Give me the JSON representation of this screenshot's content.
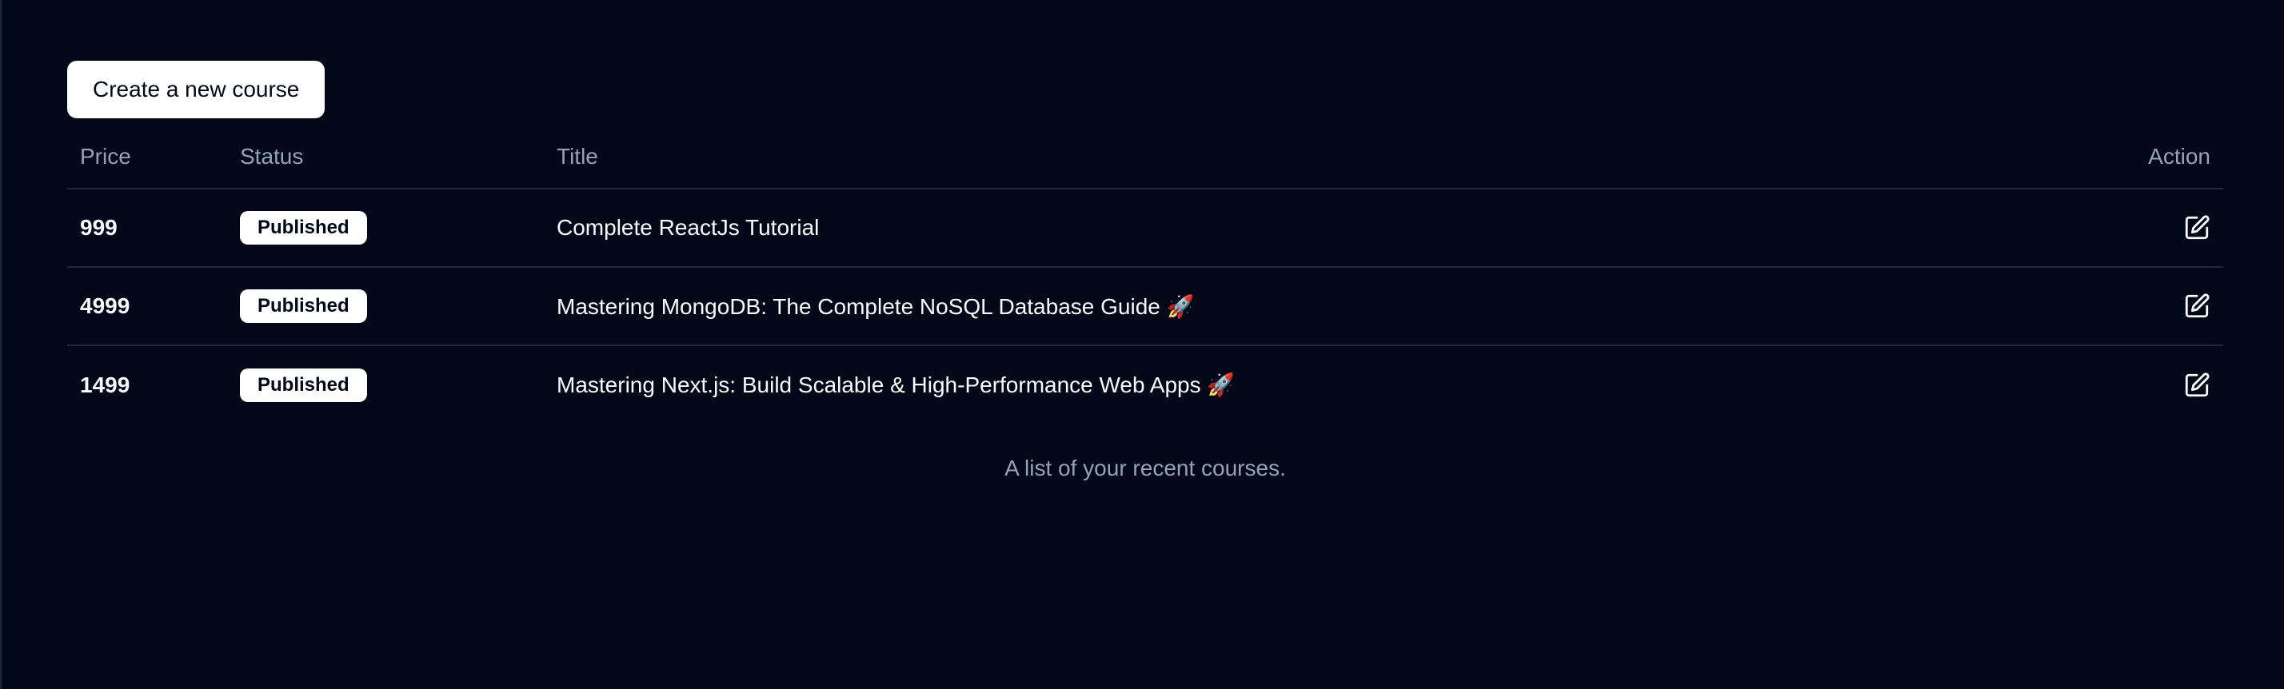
{
  "toolbar": {
    "create_label": "Create a new course"
  },
  "table": {
    "headers": {
      "price": "Price",
      "status": "Status",
      "title": "Title",
      "action": "Action"
    },
    "rows": [
      {
        "price": "999",
        "status": "Published",
        "title": "Complete ReactJs Tutorial"
      },
      {
        "price": "4999",
        "status": "Published",
        "title": "Mastering MongoDB: The Complete NoSQL Database Guide 🚀"
      },
      {
        "price": "1499",
        "status": "Published",
        "title": "Mastering Next.js: Build Scalable & High-Performance Web Apps 🚀"
      }
    ],
    "caption": "A list of your recent courses.",
    "action_icon": "edit-icon"
  },
  "colors": {
    "background": "#020817",
    "border": "#1e293b",
    "muted_text": "#94a3b8",
    "text": "#f8fafc",
    "button_bg": "#ffffff"
  }
}
